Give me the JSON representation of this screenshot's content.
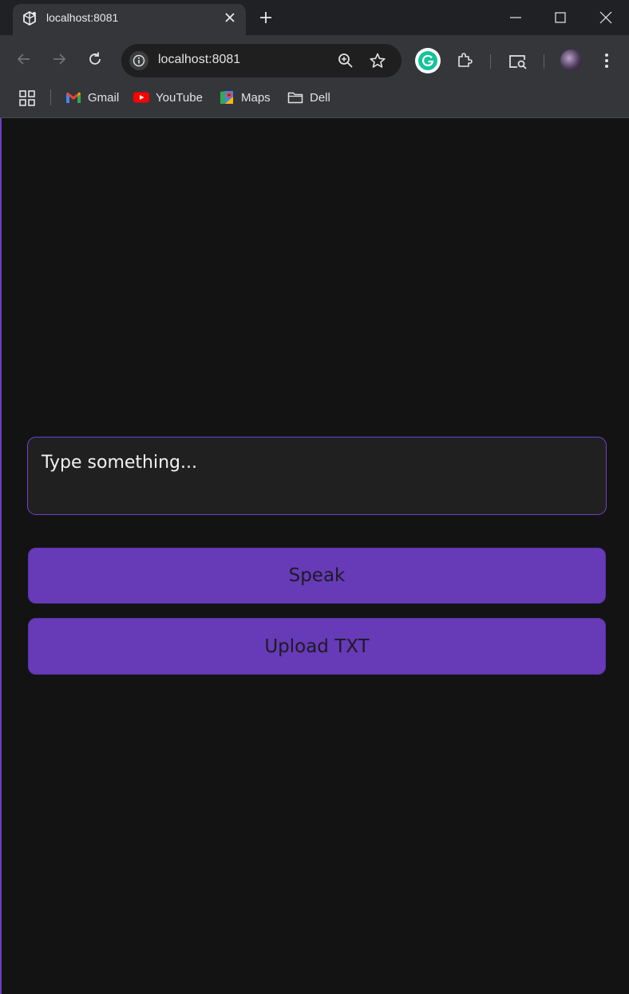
{
  "tab": {
    "title": "localhost:8081",
    "favicon": "cube-favicon-icon",
    "close_icon": "close-icon"
  },
  "window_controls": [
    "minimize-icon",
    "maximize-icon",
    "close-icon"
  ],
  "toolbar": {
    "url": "localhost:8081",
    "icons": [
      "back-arrow-icon",
      "forward-arrow-icon",
      "reload-icon",
      "site-info-icon",
      "zoom-icon",
      "star-icon",
      "grammarly-icon",
      "extensions-icon",
      "search-tab-icon",
      "avatar",
      "more-menu-icon"
    ]
  },
  "bookmarks": [
    {
      "label": "Gmail",
      "icon": "gmail-icon"
    },
    {
      "label": "YouTube",
      "icon": "youtube-icon"
    },
    {
      "label": "Maps",
      "icon": "maps-icon"
    },
    {
      "label": "Dell",
      "icon": "folder-icon"
    }
  ],
  "main": {
    "input_placeholder": "Type something...",
    "input_value": "",
    "speak_label": "Speak",
    "upload_label": "Upload TXT"
  },
  "colors": {
    "accent": "#673ab7",
    "input_border": "#6f44c8",
    "page_background": "#131314",
    "input_background": "#202021"
  }
}
